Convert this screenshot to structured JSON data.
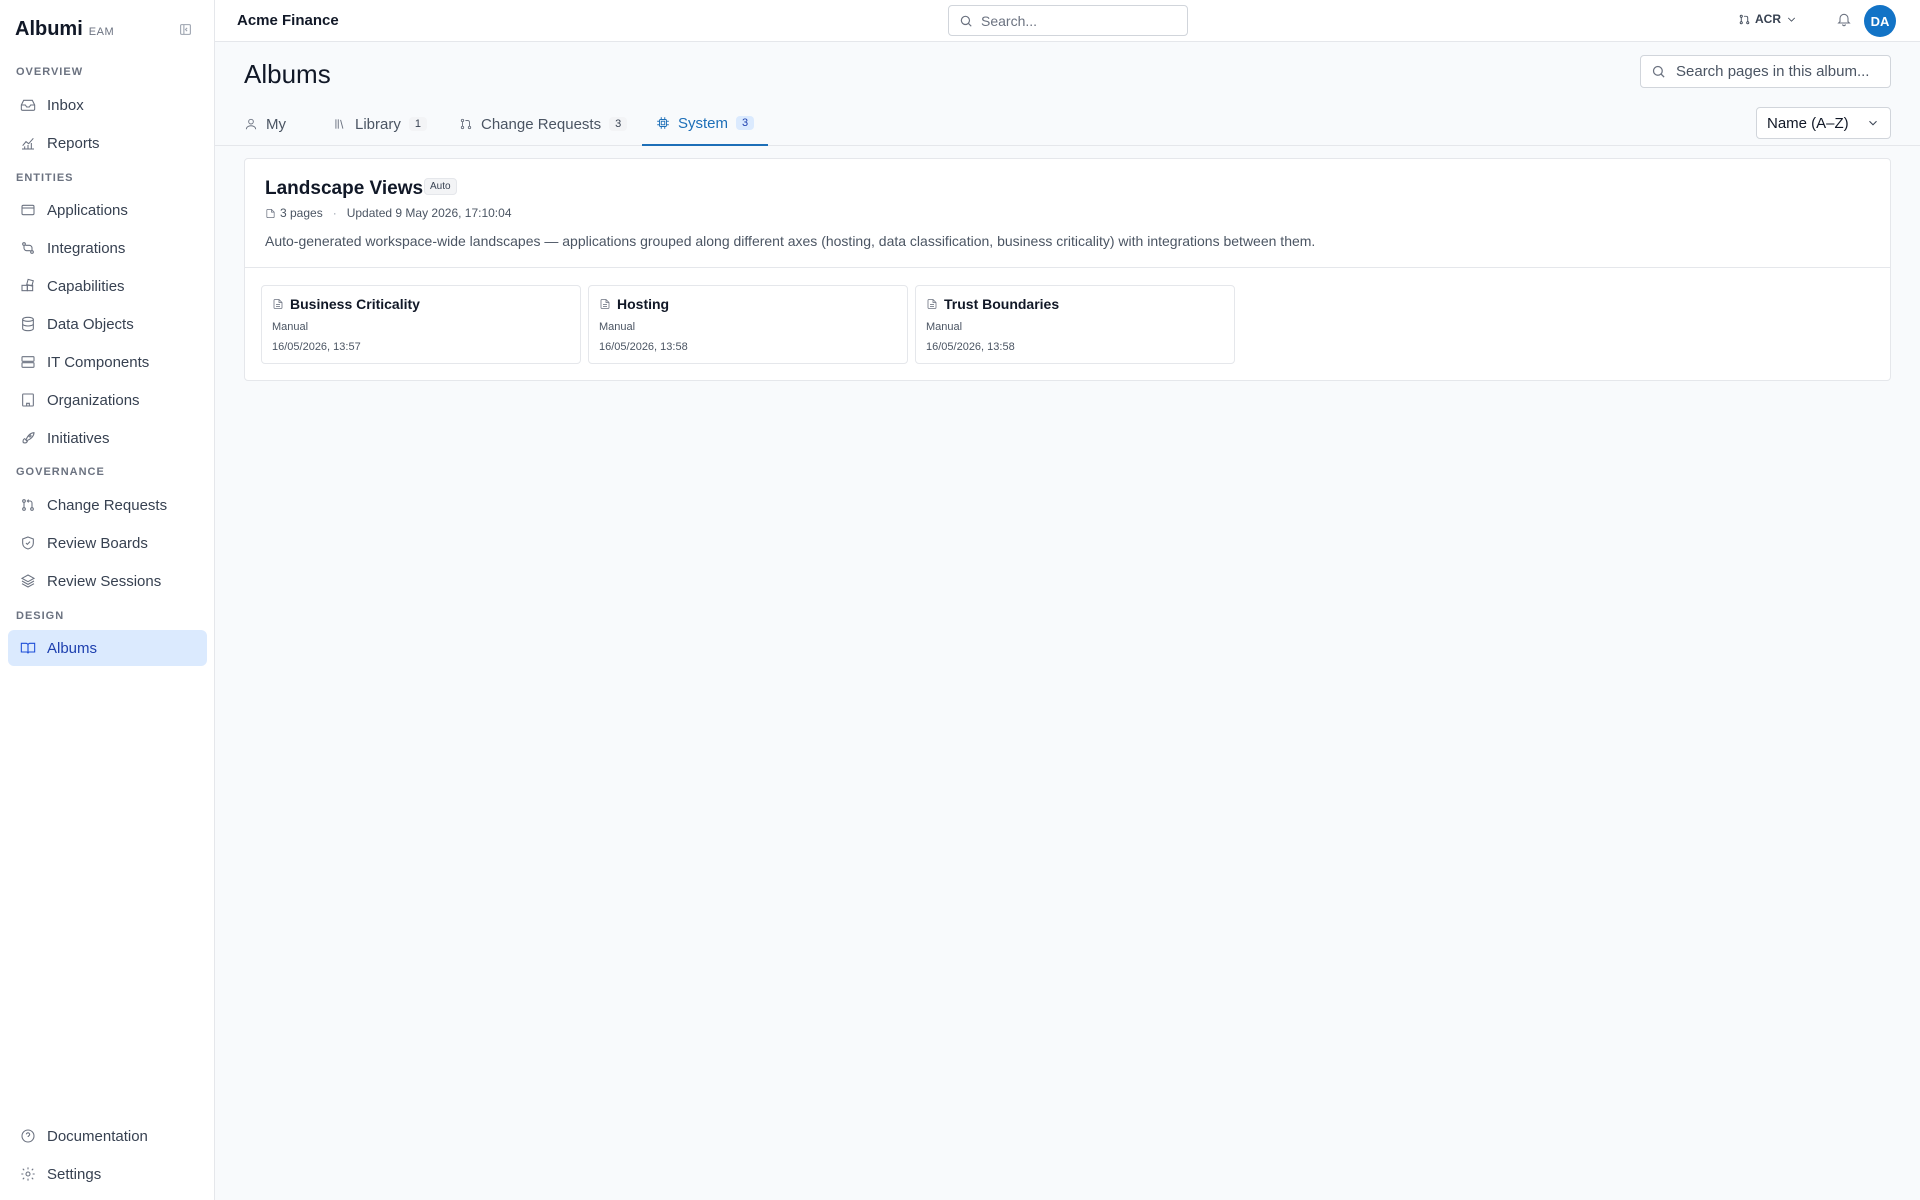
{
  "brand": {
    "name": "Albumi",
    "sub": "EAM"
  },
  "sidebar": {
    "sections": [
      {
        "title": "OVERVIEW",
        "items": [
          {
            "label": "Inbox"
          },
          {
            "label": "Reports"
          }
        ]
      },
      {
        "title": "ENTITIES",
        "items": [
          {
            "label": "Applications"
          },
          {
            "label": "Integrations"
          },
          {
            "label": "Capabilities"
          },
          {
            "label": "Data Objects"
          },
          {
            "label": "IT Components"
          },
          {
            "label": "Organizations"
          },
          {
            "label": "Initiatives"
          }
        ]
      },
      {
        "title": "GOVERNANCE",
        "items": [
          {
            "label": "Change Requests"
          },
          {
            "label": "Review Boards"
          },
          {
            "label": "Review Sessions"
          }
        ]
      },
      {
        "title": "DESIGN",
        "items": [
          {
            "label": "Albums"
          }
        ]
      }
    ],
    "footer": [
      {
        "label": "Documentation"
      },
      {
        "label": "Settings"
      }
    ],
    "active": "Albums"
  },
  "topbar": {
    "workspace": "Acme Finance",
    "search_placeholder": "Search...",
    "acr_label": "ACR",
    "avatar_initials": "DA"
  },
  "main": {
    "title": "Albums",
    "album_search_placeholder": "Search pages in this album...",
    "tabs": [
      {
        "label": "My",
        "count": "",
        "icon": "user-icon"
      },
      {
        "label": "Library",
        "count": "1",
        "icon": "library-icon"
      },
      {
        "label": "Change Requests",
        "count": "3",
        "icon": "git-pull-request-icon"
      },
      {
        "label": "System",
        "count": "3",
        "icon": "cpu-icon"
      }
    ],
    "active_tab": "System",
    "sort": "Name (A–Z)",
    "album": {
      "name": "Landscape Views",
      "badge": "Auto",
      "pages_count": "3 pages",
      "updated": "Updated 9 May 2026, 17:10:04",
      "description": "Auto-generated workspace-wide landscapes — applications grouped along different axes (hosting, data classification, business criticality) with integrations between them.",
      "pages": [
        {
          "title": "Business Criticality",
          "type": "Manual",
          "date": "16/05/2026, 13:57"
        },
        {
          "title": "Hosting",
          "type": "Manual",
          "date": "16/05/2026, 13:58"
        },
        {
          "title": "Trust Boundaries",
          "type": "Manual",
          "date": "16/05/2026, 13:58"
        }
      ]
    }
  },
  "colors": {
    "accent": "#1d6fb8",
    "active_bg": "#dbeafe",
    "avatar": "#1273c6"
  }
}
